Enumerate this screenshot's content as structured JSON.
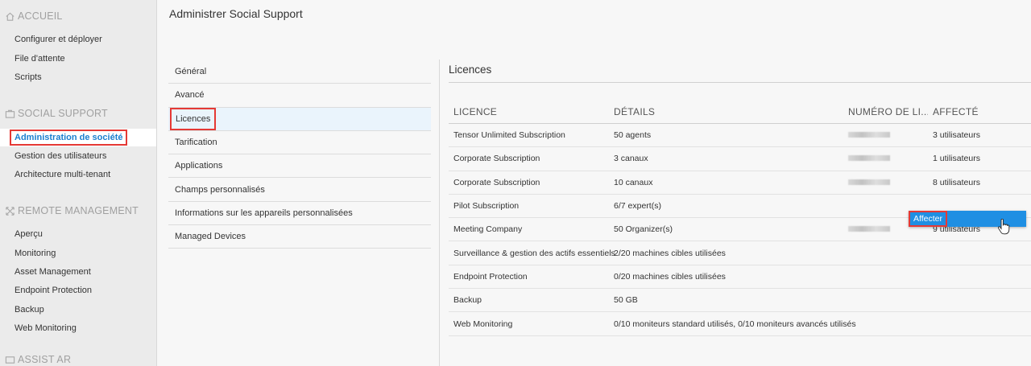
{
  "sidebar": {
    "sections": [
      {
        "title": "ACCUEIL",
        "icon": "home-icon",
        "items": [
          "Configurer et déployer",
          "File d'attente",
          "Scripts"
        ]
      },
      {
        "title": "SOCIAL SUPPORT",
        "icon": "briefcase-icon",
        "items": [
          "Administration de société",
          "Gestion des utilisateurs",
          "Architecture multi-tenant"
        ]
      },
      {
        "title": "REMOTE MANAGEMENT",
        "icon": "arrows-icon",
        "items": [
          "Aperçu",
          "Monitoring",
          "Asset Management",
          "Endpoint Protection",
          "Backup",
          "Web Monitoring"
        ]
      },
      {
        "title": "ASSIST AR",
        "icon": "ar-icon",
        "items": []
      }
    ],
    "active_item": "Administration de société"
  },
  "page_title": "Administrer Social Support",
  "settings_menu": {
    "items": [
      "Général",
      "Avancé",
      "Licences",
      "Tarification",
      "Applications",
      "Champs personnalisés",
      "Informations sur les appareils personnalisées",
      "Managed Devices"
    ],
    "active": "Licences"
  },
  "section_title": "Licences",
  "table": {
    "headers": [
      "LICENCE",
      "DÉTAILS",
      "NUMÉRO DE LI...",
      "AFFECTÉ"
    ],
    "rows": [
      {
        "licence": "Tensor Unlimited Subscription",
        "details": "50 agents",
        "number_blurred": true,
        "assigned": "3 utilisateurs"
      },
      {
        "licence": "Corporate Subscription",
        "details": "3 canaux",
        "number_blurred": true,
        "assigned": "1 utilisateurs"
      },
      {
        "licence": "Corporate Subscription",
        "details": "10 canaux",
        "number_blurred": true,
        "assigned": "8 utilisateurs"
      },
      {
        "licence": "Pilot Subscription",
        "details": "6/7 expert(s)",
        "number_blurred": false,
        "assigned": ""
      },
      {
        "licence": "Meeting Company",
        "details": "50 Organizer(s)",
        "number_blurred": true,
        "assigned": "9 utilisateurs"
      },
      {
        "licence": "Surveillance & gestion des actifs essentiels",
        "details": "2/20 machines cibles utilisées",
        "number_blurred": false,
        "assigned": ""
      },
      {
        "licence": "Endpoint Protection",
        "details": "0/20 machines cibles utilisées",
        "number_blurred": false,
        "assigned": ""
      },
      {
        "licence": "Backup",
        "details": "50 GB",
        "number_blurred": false,
        "assigned": ""
      },
      {
        "licence": "Web Monitoring",
        "details": "0/10 moniteurs standard utilisés, 0/10 moniteurs avancés utilisés",
        "number_blurred": false,
        "assigned": ""
      }
    ]
  },
  "context_menu": {
    "items": [
      "Affecter"
    ]
  },
  "kebab_icon": "more-vertical-icon",
  "colors": {
    "accent": "#1f8fe3",
    "highlight": "#e53935",
    "active_link": "#1a7fcf"
  }
}
